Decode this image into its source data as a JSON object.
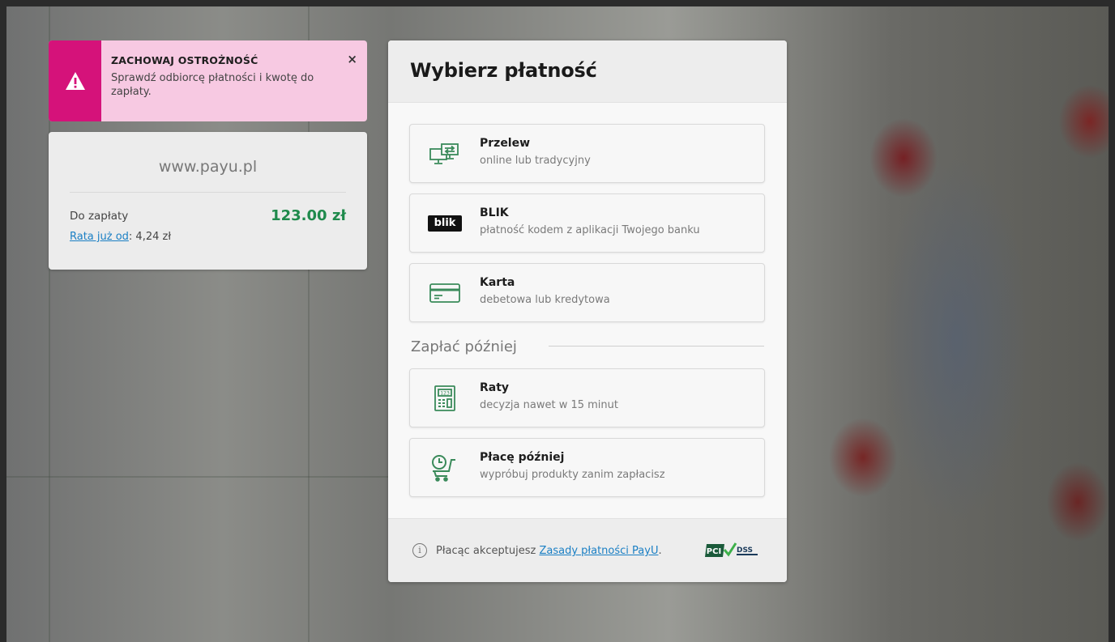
{
  "warning": {
    "title": "ZACHOWAJ OSTROŻNOŚĆ",
    "text": "Sprawdź odbiorcę płatności i kwotę do zapłaty.",
    "close": "×"
  },
  "merchant": {
    "name": "www.payu.pl",
    "amount_label": "Do zapłaty",
    "amount_value": "123.00 zł",
    "installment_link": "Rata już od",
    "installment_value": ": 4,24 zł"
  },
  "panel": {
    "title": "Wybierz płatność",
    "options": [
      {
        "title": "Przelew",
        "subtitle": "online lub tradycyjny",
        "icon": "transfer-icon"
      },
      {
        "title": "BLIK",
        "subtitle": "płatność kodem z aplikacji Twojego banku",
        "icon": "blik-logo",
        "icon_text": "blik"
      },
      {
        "title": "Karta",
        "subtitle": "debetowa lub kredytowa",
        "icon": "card-icon"
      }
    ],
    "later_label": "Zapłać później",
    "later_options": [
      {
        "title": "Raty",
        "subtitle": "decyzja nawet w 15 minut",
        "icon": "calculator-icon",
        "icon_text": "123"
      },
      {
        "title": "Płacę później",
        "subtitle": "wypróbuj produkty zanim zapłacisz",
        "icon": "cart-clock-icon"
      }
    ],
    "footer": {
      "info_icon": "i",
      "text": "Płacąc akceptujesz ",
      "link": "Zasady płatności PayU",
      "after": ".",
      "badge": "PCI DSS"
    }
  },
  "colors": {
    "accent_green": "#1f8a4c",
    "warning_magenta": "#d5127a",
    "link_blue": "#1a7fc4",
    "icon_green": "#3a8a5a"
  }
}
